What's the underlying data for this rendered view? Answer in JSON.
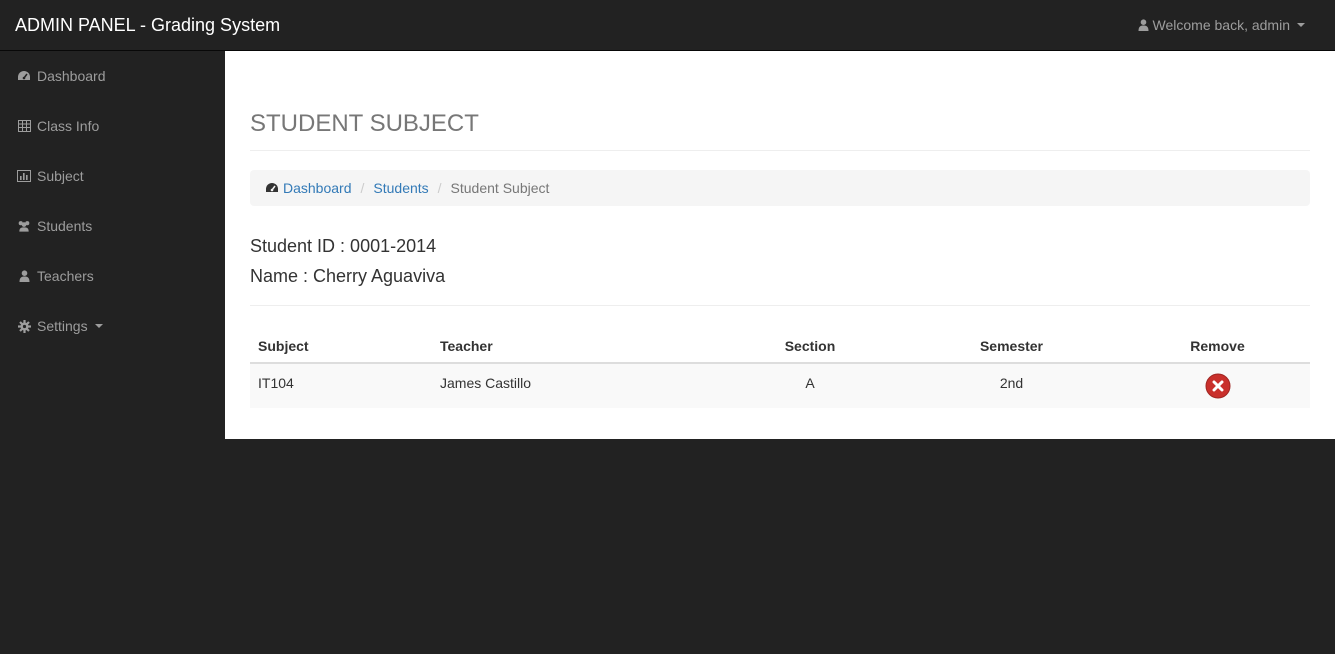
{
  "navbar": {
    "brand": "ADMIN PANEL - Grading System",
    "user_menu": "Welcome back, admin"
  },
  "sidebar": {
    "items": [
      {
        "label": "Dashboard",
        "icon": "dashboard-icon"
      },
      {
        "label": "Class Info",
        "icon": "table-icon"
      },
      {
        "label": "Subject",
        "icon": "bar-chart-icon"
      },
      {
        "label": "Students",
        "icon": "users-icon"
      },
      {
        "label": "Teachers",
        "icon": "user-icon"
      },
      {
        "label": "Settings",
        "icon": "gear-icon"
      }
    ]
  },
  "page": {
    "title": "STUDENT SUBJECT",
    "breadcrumb": [
      "Dashboard",
      "Students",
      "Student Subject"
    ],
    "student_id": "Student ID : 0001-2014",
    "student_name": "Name : Cherry Aguaviva"
  },
  "table": {
    "headers": [
      "Subject",
      "Teacher",
      "Section",
      "Semester",
      "Remove"
    ],
    "rows": [
      {
        "subject": "IT104",
        "teacher": "James Castillo",
        "section": "A",
        "semester": "2nd"
      }
    ]
  },
  "colors": {
    "navbar_bg": "#222222",
    "link": "#337ab7",
    "remove": "#c9302c"
  }
}
